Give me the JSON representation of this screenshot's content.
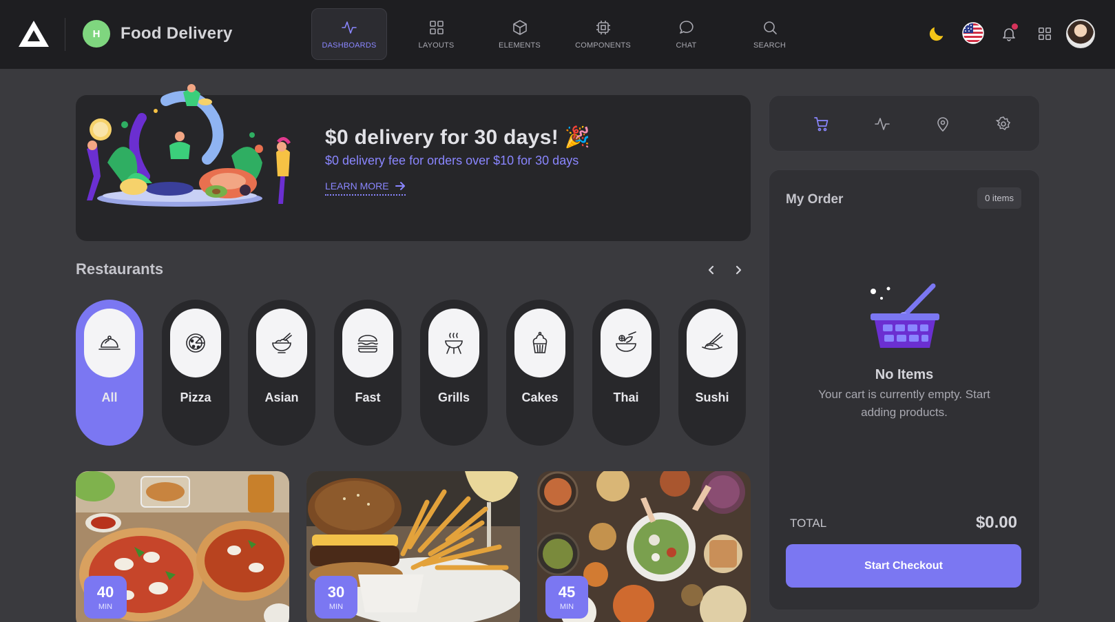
{
  "header": {
    "app_initial": "H",
    "app_title": "Food Delivery",
    "nav": [
      {
        "label": "DASHBOARDS",
        "icon": "activity-icon"
      },
      {
        "label": "LAYOUTS",
        "icon": "grid-icon"
      },
      {
        "label": "ELEMENTS",
        "icon": "cube-icon"
      },
      {
        "label": "COMPONENTS",
        "icon": "chip-icon"
      },
      {
        "label": "CHAT",
        "icon": "chat-bubble-icon"
      },
      {
        "label": "SEARCH",
        "icon": "search-icon"
      }
    ],
    "active_nav": "DASHBOARDS"
  },
  "banner": {
    "title": "$0 delivery for 30 days! 🎉",
    "subtitle": "$0 delivery fee for orders over $10 for 30 days",
    "cta": "LEARN MORE"
  },
  "restaurants": {
    "title": "Restaurants",
    "categories": [
      {
        "label": "All",
        "icon": "food-cloche-icon",
        "active": true
      },
      {
        "label": "Pizza",
        "icon": "pizza-icon"
      },
      {
        "label": "Asian",
        "icon": "rice-bowl-icon"
      },
      {
        "label": "Fast",
        "icon": "burger-icon"
      },
      {
        "label": "Grills",
        "icon": "grill-icon"
      },
      {
        "label": "Cakes",
        "icon": "cupcake-icon"
      },
      {
        "label": "Thai",
        "icon": "salad-bowl-icon"
      },
      {
        "label": "Sushi",
        "icon": "sushi-icon"
      }
    ]
  },
  "food_cards": [
    {
      "time": "40",
      "unit": "MIN"
    },
    {
      "time": "30",
      "unit": "MIN"
    },
    {
      "time": "45",
      "unit": "MIN"
    }
  ],
  "order": {
    "title": "My Order",
    "items_badge": "0 items",
    "empty_title": "No Items",
    "empty_text": "Your cart is currently empty. Start adding products.",
    "total_label": "TOTAL",
    "total_value": "$0.00",
    "checkout_label": "Start Checkout"
  },
  "colors": {
    "accent": "#7b77f2",
    "background": "#3a3a3e",
    "header": "#1e1e21",
    "card": "#262629"
  }
}
